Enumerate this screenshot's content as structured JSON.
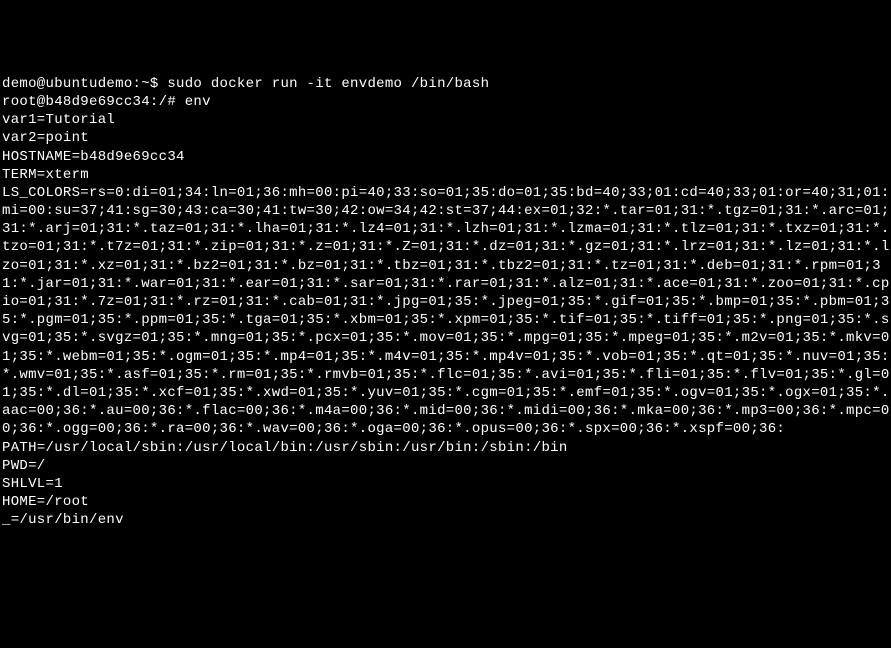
{
  "terminal": {
    "lines": [
      "demo@ubuntudemo:~$ sudo docker run -it envdemo /bin/bash",
      "root@b48d9e69cc34:/# env",
      "var1=Tutorial",
      "var2=point",
      "HOSTNAME=b48d9e69cc34",
      "TERM=xterm",
      "LS_COLORS=rs=0:di=01;34:ln=01;36:mh=00:pi=40;33:so=01;35:do=01;35:bd=40;33;01:cd=40;33;01:or=40;31;01:mi=00:su=37;41:sg=30;43:ca=30;41:tw=30;42:ow=34;42:st=37;44:ex=01;32:*.tar=01;31:*.tgz=01;31:*.arc=01;31:*.arj=01;31:*.taz=01;31:*.lha=01;31:*.lz4=01;31:*.lzh=01;31:*.lzma=01;31:*.tlz=01;31:*.txz=01;31:*.tzo=01;31:*.t7z=01;31:*.zip=01;31:*.z=01;31:*.Z=01;31:*.dz=01;31:*.gz=01;31:*.lrz=01;31:*.lz=01;31:*.lzo=01;31:*.xz=01;31:*.bz2=01;31:*.bz=01;31:*.tbz=01;31:*.tbz2=01;31:*.tz=01;31:*.deb=01;31:*.rpm=01;31:*.jar=01;31:*.war=01;31:*.ear=01;31:*.sar=01;31:*.rar=01;31:*.alz=01;31:*.ace=01;31:*.zoo=01;31:*.cpio=01;31:*.7z=01;31:*.rz=01;31:*.cab=01;31:*.jpg=01;35:*.jpeg=01;35:*.gif=01;35:*.bmp=01;35:*.pbm=01;35:*.pgm=01;35:*.ppm=01;35:*.tga=01;35:*.xbm=01;35:*.xpm=01;35:*.tif=01;35:*.tiff=01;35:*.png=01;35:*.svg=01;35:*.svgz=01;35:*.mng=01;35:*.pcx=01;35:*.mov=01;35:*.mpg=01;35:*.mpeg=01;35:*.m2v=01;35:*.mkv=01;35:*.webm=01;35:*.ogm=01;35:*.mp4=01;35:*.m4v=01;35:*.mp4v=01;35:*.vob=01;35:*.qt=01;35:*.nuv=01;35:*.wmv=01;35:*.asf=01;35:*.rm=01;35:*.rmvb=01;35:*.flc=01;35:*.avi=01;35:*.fli=01;35:*.flv=01;35:*.gl=01;35:*.dl=01;35:*.xcf=01;35:*.xwd=01;35:*.yuv=01;35:*.cgm=01;35:*.emf=01;35:*.ogv=01;35:*.ogx=01;35:*.aac=00;36:*.au=00;36:*.flac=00;36:*.m4a=00;36:*.mid=00;36:*.midi=00;36:*.mka=00;36:*.mp3=00;36:*.mpc=00;36:*.ogg=00;36:*.ra=00;36:*.wav=00;36:*.oga=00;36:*.opus=00;36:*.spx=00;36:*.xspf=00;36:",
      "PATH=/usr/local/sbin:/usr/local/bin:/usr/sbin:/usr/bin:/sbin:/bin",
      "PWD=/",
      "SHLVL=1",
      "HOME=/root",
      "_=/usr/bin/env"
    ]
  }
}
